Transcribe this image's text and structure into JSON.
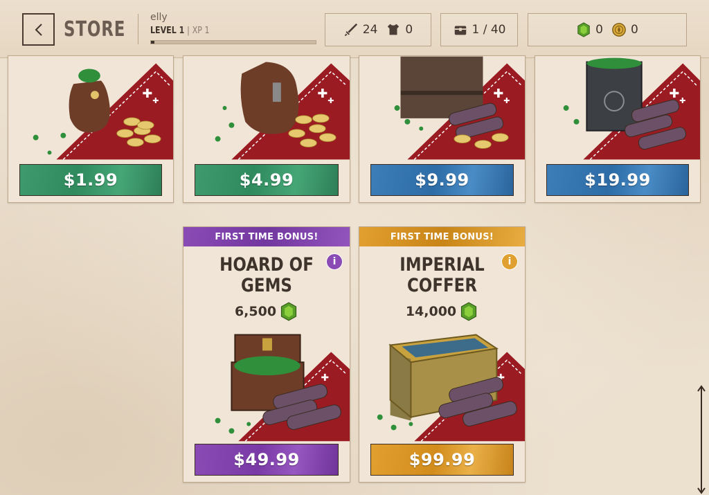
{
  "header": {
    "back_icon": "chevron-left-icon",
    "title": "STORE",
    "username": "elly",
    "level_label": "LEVEL 1",
    "separator": "|",
    "xp_label": "XP 1",
    "xp_progress": 0.02,
    "attack_value": "24",
    "defense_value": "0",
    "inventory_value": "1 / 40",
    "gems_value": "0",
    "gold_value": "0"
  },
  "products": [
    {
      "price": "$1.99",
      "color": "green"
    },
    {
      "price": "$4.99",
      "color": "green"
    },
    {
      "price": "$9.99",
      "color": "blue"
    },
    {
      "price": "$19.99",
      "color": "blue"
    }
  ],
  "featured": [
    {
      "bonus": "FIRST TIME BONUS!",
      "title_line1": "HOARD OF",
      "title_line2": "GEMS",
      "gems": "6,500",
      "price": "$49.99",
      "info": "i"
    },
    {
      "bonus": "FIRST TIME BONUS!",
      "title_line1": "IMPERIAL",
      "title_line2": "COFFER",
      "gems": "14,000",
      "price": "$99.99",
      "info": "i"
    }
  ],
  "colors": {
    "green": "#2f8a5e",
    "blue": "#2d6ca6",
    "purple": "#7a3aa6",
    "orange": "#d28c1c",
    "banner_red": "#9b1b22"
  }
}
